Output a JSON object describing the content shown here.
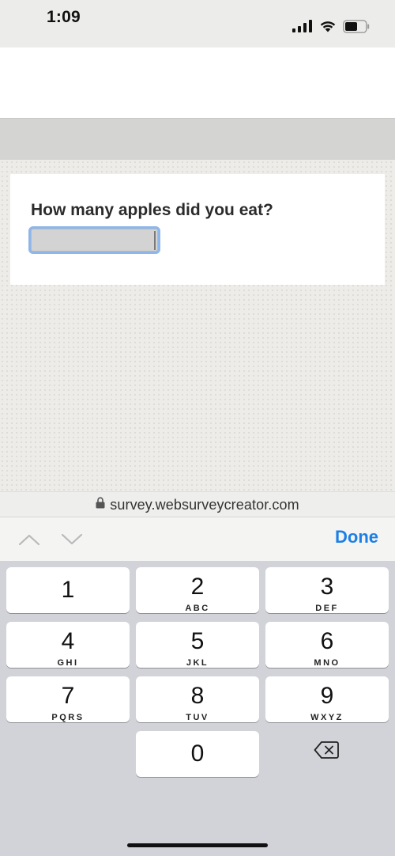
{
  "status_bar": {
    "time": "1:09",
    "icons": [
      "cellular-signal-icon",
      "wifi-icon",
      "battery-icon"
    ]
  },
  "survey": {
    "question": "How many apples did you eat?",
    "answer_value": "",
    "answer_placeholder": ""
  },
  "browser": {
    "url": "survey.websurveycreator.com",
    "lock_icon": "lock-icon"
  },
  "accessory_bar": {
    "prev_icon": "chevron-up-icon",
    "next_icon": "chevron-down-icon",
    "done_label": "Done"
  },
  "keypad": {
    "keys": [
      {
        "digit": "1",
        "letters": ""
      },
      {
        "digit": "2",
        "letters": "ABC"
      },
      {
        "digit": "3",
        "letters": "DEF"
      },
      {
        "digit": "4",
        "letters": "GHI"
      },
      {
        "digit": "5",
        "letters": "JKL"
      },
      {
        "digit": "6",
        "letters": "MNO"
      },
      {
        "digit": "7",
        "letters": "PQRS"
      },
      {
        "digit": "8",
        "letters": "TUV"
      },
      {
        "digit": "9",
        "letters": "WXYZ"
      },
      {
        "digit": "0",
        "letters": ""
      }
    ],
    "delete_icon": "backspace-icon"
  },
  "colors": {
    "accent": "#1c7fe6",
    "keypad_background": "#d2d3d8",
    "key_background": "#ffffff",
    "input_focus_border": "#8db6ea"
  }
}
